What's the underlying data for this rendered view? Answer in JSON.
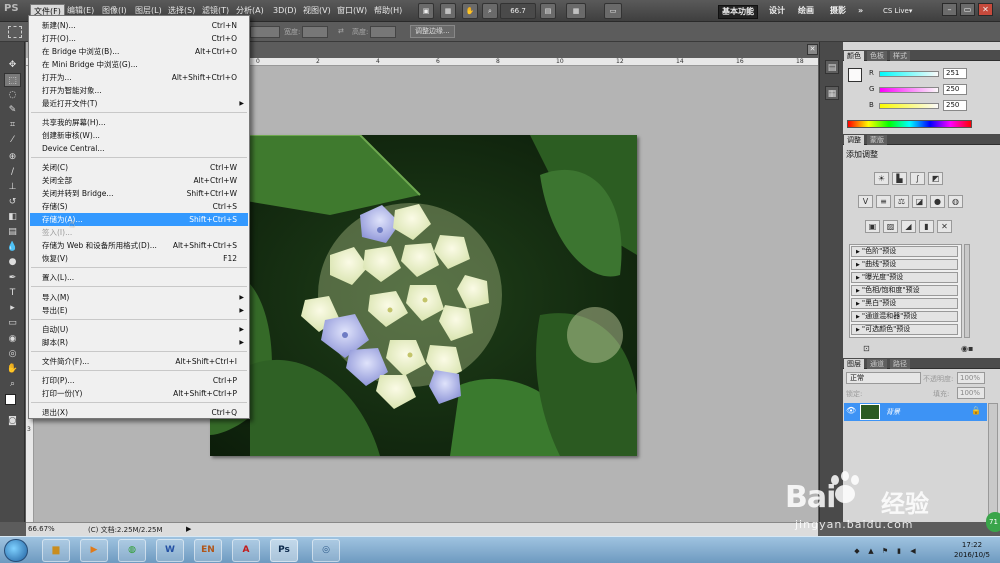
{
  "app": {
    "logo": "PS"
  },
  "menubar": {
    "items": [
      "文件(F)",
      "编辑(E)",
      "图像(I)",
      "图层(L)",
      "选择(S)",
      "滤镜(T)",
      "分析(A)",
      "3D(D)",
      "视图(V)",
      "窗口(W)",
      "帮助(H)"
    ],
    "zoom": "66.7",
    "workspaces": [
      "基本功能",
      "设计",
      "绘画",
      "摄影",
      "»"
    ],
    "cs_live": "CS Live▾"
  },
  "options_bar": {
    "width_label": "宽度:",
    "height_label": "高度:",
    "refine_edge": "调整边缘..."
  },
  "file_menu": {
    "items": [
      {
        "label": "新建(N)...",
        "shortcut": "Ctrl+N"
      },
      {
        "label": "打开(O)...",
        "shortcut": "Ctrl+O"
      },
      {
        "label": "在 Bridge 中浏览(B)...",
        "shortcut": "Alt+Ctrl+O"
      },
      {
        "label": "在 Mini Bridge 中浏览(G)...",
        "shortcut": ""
      },
      {
        "label": "打开为...",
        "shortcut": "Alt+Shift+Ctrl+O"
      },
      {
        "label": "打开为智能对象...",
        "shortcut": ""
      },
      {
        "label": "最近打开文件(T)",
        "shortcut": "",
        "submenu": true
      },
      {
        "label": "共享我的屏幕(H)...",
        "shortcut": ""
      },
      {
        "label": "创建新审核(W)...",
        "shortcut": ""
      },
      {
        "label": "Device Central...",
        "shortcut": ""
      },
      {
        "label": "关闭(C)",
        "shortcut": "Ctrl+W"
      },
      {
        "label": "关闭全部",
        "shortcut": "Alt+Ctrl+W"
      },
      {
        "label": "关闭并转到 Bridge...",
        "shortcut": "Shift+Ctrl+W"
      },
      {
        "label": "存储(S)",
        "shortcut": "Ctrl+S"
      },
      {
        "label": "存储为(A)...",
        "shortcut": "Shift+Ctrl+S",
        "highlighted": true
      },
      {
        "label": "签入(I)...",
        "shortcut": "",
        "disabled": true
      },
      {
        "label": "存储为 Web 和设备所用格式(D)...",
        "shortcut": "Alt+Shift+Ctrl+S"
      },
      {
        "label": "恢复(V)",
        "shortcut": "F12"
      },
      {
        "label": "置入(L)...",
        "shortcut": ""
      },
      {
        "label": "导入(M)",
        "shortcut": "",
        "submenu": true
      },
      {
        "label": "导出(E)",
        "shortcut": "",
        "submenu": true
      },
      {
        "label": "自动(U)",
        "shortcut": "",
        "submenu": true
      },
      {
        "label": "脚本(R)",
        "shortcut": "",
        "submenu": true
      },
      {
        "label": "文件简介(F)...",
        "shortcut": "Alt+Shift+Ctrl+I"
      },
      {
        "label": "打印(P)...",
        "shortcut": "Ctrl+P"
      },
      {
        "label": "打印一份(Y)",
        "shortcut": "Alt+Shift+Ctrl+P"
      },
      {
        "label": "退出(X)",
        "shortcut": "Ctrl+Q"
      }
    ]
  },
  "rulers": {
    "top": [
      "0",
      "2",
      "4",
      "6",
      "8",
      "10",
      "12",
      "14",
      "16",
      "18"
    ],
    "left": [
      "1",
      "2",
      "3"
    ]
  },
  "statusbar": {
    "zoom": "66.67%",
    "doc_info": "(C) 文档:2.25M/2.25M"
  },
  "color_panel": {
    "tabs": [
      "颜色",
      "色板",
      "样式"
    ],
    "r_label": "R",
    "g_label": "G",
    "b_label": "B",
    "r": "251",
    "g": "250",
    "b": "250"
  },
  "adjust_panel": {
    "tabs": [
      "调整",
      "蒙版"
    ],
    "title": "添加调整",
    "presets": [
      "\"色阶\"预设",
      "\"曲线\"预设",
      "\"曝光度\"预设",
      "\"色相/饱和度\"预设",
      "\"黑白\"预设",
      "\"通道混和器\"预设",
      "\"可选颜色\"预设"
    ]
  },
  "layers_panel": {
    "tabs": [
      "图层",
      "通道",
      "路径"
    ],
    "blend_mode": "正常",
    "opacity_label": "不透明度:",
    "opacity": "100%",
    "lock_label": "锁定:",
    "fill_label": "填充:",
    "fill": "100%",
    "layer_name": "背景"
  },
  "watermark": {
    "brand": "Bai",
    "brand2": "经验",
    "url": "jingyan.baidu.com"
  },
  "taskbar": {
    "time": "17:22",
    "date": "2016/10/5",
    "badge": "71"
  },
  "colors": {
    "highlight": "#3399ff",
    "layer_selected": "#3d93f5"
  }
}
